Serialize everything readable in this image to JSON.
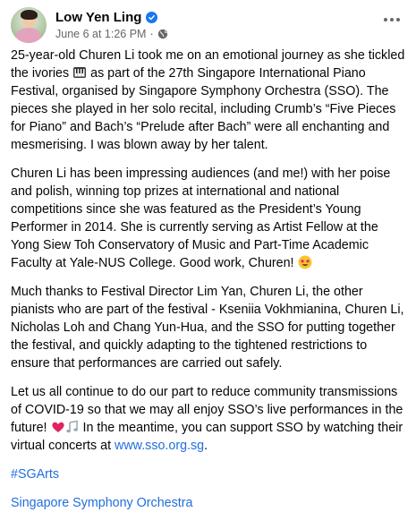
{
  "post": {
    "author": "Low Yen Ling",
    "timestamp": "June 6 at 1:26 PM",
    "separator": "·",
    "paragraphs": [
      {
        "parts": [
          "25-year-old Churen Li took me on an emotional journey as she tickled the ivories ",
          " as part of the 27th Singapore International Piano Festival, organised by Singapore Symphony Orchestra (SSO). The pieces she played in her solo recital, including Crumb’s “Five Pieces for Piano” and Bach’s “Prelude after Bach” were all enchanting and mesmerising. I was blown away by her talent."
        ]
      },
      {
        "parts": [
          "Churen Li has been impressing audiences (and me!) with her poise and polish, winning top prizes at international and national competitions since she was featured as the President’s Young Performer in 2014. She is currently serving as Artist Fellow at the Yong Siew Toh Conservatory of Music and Part-Time Academic Faculty at Yale-NUS College. Good work, Churen! "
        ]
      },
      {
        "parts": [
          "Much thanks to Festival Director Lim Yan, Churen Li, the other pianists who are part of the festival - Kseniia Vokhmianina, Churen Li, Nicholas Loh and Chang Yun-Hua, and the SSO for putting together the festival, and quickly adapting to the tightened restrictions to ensure that performances are carried out safely."
        ]
      },
      {
        "parts": [
          "Let us all continue to do our part to reduce community transmissions of COVID-19 so that we may all enjoy SSO’s live performances in the future! ",
          " In the meantime, you can support SSO by watching their virtual concerts at ",
          "."
        ],
        "link": "www.sso.org.sg"
      }
    ],
    "hashtag": "#SGArts",
    "mention": "Singapore Symphony Orchestra"
  },
  "icons": [
    "verified-badge-icon",
    "globe-icon",
    "more-options-icon",
    "piano-emoji-icon",
    "star-struck-emoji-icon",
    "heart-emoji-icon",
    "music-notes-emoji-icon"
  ],
  "colors": {
    "link": "#216fdb",
    "verified": "#1877f2",
    "meta": "#65676b",
    "text": "#050505"
  }
}
